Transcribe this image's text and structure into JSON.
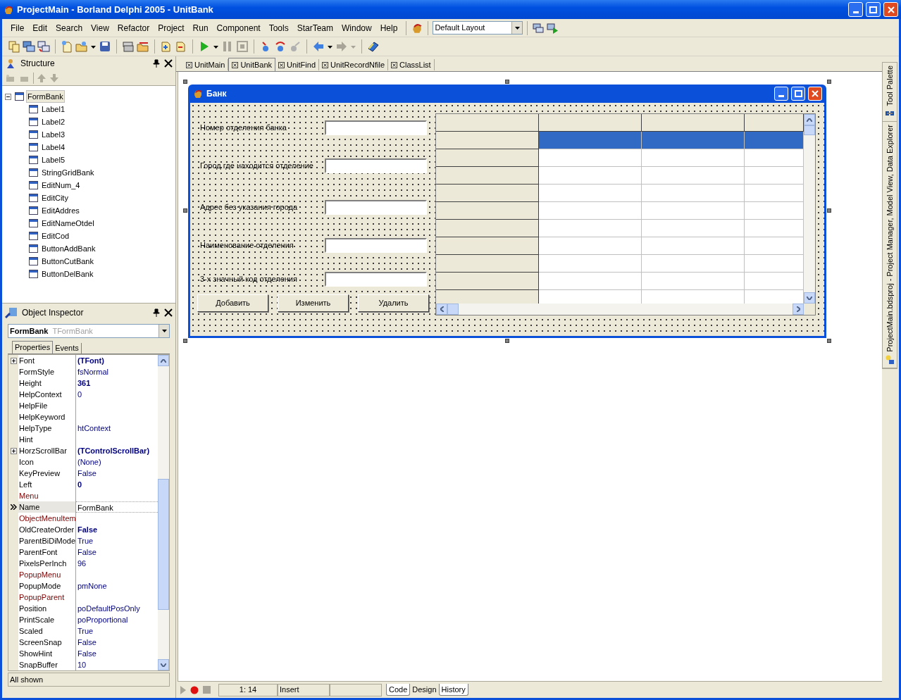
{
  "window": {
    "title": "ProjectMain - Borland Delphi 2005 - UnitBank"
  },
  "menu": [
    "File",
    "Edit",
    "Search",
    "View",
    "Refactor",
    "Project",
    "Run",
    "Component",
    "Tools",
    "StarTeam",
    "Window",
    "Help"
  ],
  "layout_selector": {
    "value": "Default Layout"
  },
  "structure": {
    "title": "Structure",
    "tree": [
      {
        "label": "FormBank",
        "expanded": true,
        "selected": true,
        "children": [
          {
            "label": "Label1",
            "selected": false
          },
          {
            "label": "Label2",
            "selected": false
          },
          {
            "label": "Label3",
            "selected": false
          },
          {
            "label": "Label4",
            "selected": false
          },
          {
            "label": "Label5",
            "selected": false
          },
          {
            "label": "StringGridBank",
            "selected": false
          },
          {
            "label": "EditNum_4",
            "selected": false
          },
          {
            "label": "EditCity",
            "selected": false
          },
          {
            "label": "EditAddres",
            "selected": false
          },
          {
            "label": "EditNameOtdel",
            "selected": false
          },
          {
            "label": "EditCod",
            "selected": false
          },
          {
            "label": "ButtonAddBank",
            "selected": false
          },
          {
            "label": "ButtonCutBank",
            "selected": false
          },
          {
            "label": "ButtonDelBank",
            "selected": false
          }
        ]
      }
    ]
  },
  "object_inspector": {
    "title": "Object Inspector",
    "object_name": "FormBank",
    "object_class": "TFormBank",
    "tabs": [
      {
        "label": "Properties",
        "selected": true
      },
      {
        "label": "Events",
        "selected": false
      }
    ],
    "properties": [
      {
        "name": "Font",
        "value": "(TFont)",
        "kind": "object",
        "modified": true,
        "selected": false
      },
      {
        "name": "FormStyle",
        "value": "fsNormal",
        "kind": "plain",
        "modified": false,
        "selected": false
      },
      {
        "name": "Height",
        "value": "361",
        "kind": "plain",
        "modified": true,
        "selected": false
      },
      {
        "name": "HelpContext",
        "value": "0",
        "kind": "plain",
        "modified": false,
        "selected": false
      },
      {
        "name": "HelpFile",
        "kind": "plain",
        "selected": false
      },
      {
        "name": "HelpKeyword",
        "kind": "plain",
        "selected": false
      },
      {
        "name": "HelpType",
        "value": "htContext",
        "kind": "plain",
        "modified": false,
        "selected": false
      },
      {
        "name": "Hint",
        "kind": "plain",
        "selected": false
      },
      {
        "name": "HorzScrollBar",
        "value": "(TControlScrollBar)",
        "kind": "object",
        "modified": true,
        "selected": false
      },
      {
        "name": "Icon",
        "value": "(None)",
        "kind": "plain",
        "modified": false,
        "selected": false
      },
      {
        "name": "KeyPreview",
        "value": "False",
        "kind": "plain",
        "modified": false,
        "selected": false
      },
      {
        "name": "Left",
        "value": "0",
        "kind": "plain",
        "modified": true,
        "selected": false
      },
      {
        "name": "Menu",
        "kind": "reference",
        "selected": false
      },
      {
        "name": "Name",
        "value": "FormBank",
        "kind": "plain",
        "modified": false,
        "selected": true
      },
      {
        "name": "ObjectMenuItem",
        "kind": "reference",
        "selected": false
      },
      {
        "name": "OldCreateOrder",
        "value": "False",
        "kind": "plain",
        "modified": true,
        "selected": false
      },
      {
        "name": "ParentBiDiMode",
        "value": "True",
        "kind": "plain",
        "modified": false,
        "selected": false
      },
      {
        "name": "ParentFont",
        "value": "False",
        "kind": "plain",
        "modified": false,
        "selected": false
      },
      {
        "name": "PixelsPerInch",
        "value": "96",
        "kind": "plain",
        "modified": false,
        "selected": false
      },
      {
        "name": "PopupMenu",
        "kind": "reference",
        "selected": false
      },
      {
        "name": "PopupMode",
        "value": "pmNone",
        "kind": "plain",
        "modified": false,
        "selected": false
      },
      {
        "name": "PopupParent",
        "kind": "reference",
        "selected": false
      },
      {
        "name": "Position",
        "value": "poDefaultPosOnly",
        "kind": "plain",
        "modified": false,
        "selected": false
      },
      {
        "name": "PrintScale",
        "value": "poProportional",
        "kind": "plain",
        "modified": false,
        "selected": false
      },
      {
        "name": "Scaled",
        "value": "True",
        "kind": "plain",
        "modified": false,
        "selected": false
      },
      {
        "name": "ScreenSnap",
        "value": "False",
        "kind": "plain",
        "modified": false,
        "selected": false
      },
      {
        "name": "ShowHint",
        "value": "False",
        "kind": "plain",
        "modified": false,
        "selected": false
      },
      {
        "name": "SnapBuffer",
        "value": "10",
        "kind": "plain",
        "modified": false,
        "selected": false
      }
    ],
    "status": "All shown"
  },
  "editor_tabs": [
    {
      "label": "UnitMain",
      "selected": false
    },
    {
      "label": "UnitBank",
      "selected": true
    },
    {
      "label": "UnitFind",
      "selected": false
    },
    {
      "label": "UnitRecordNfile",
      "selected": false
    },
    {
      "label": "ClassList",
      "selected": false
    }
  ],
  "form": {
    "title": "Банк",
    "fields": [
      {
        "label": "Номер отделения банка"
      },
      {
        "label": "Город где находится отделение"
      },
      {
        "label": "Адрес без указания города"
      },
      {
        "label": "Наименование отделения"
      },
      {
        "label": "3-х значный код отделения"
      }
    ],
    "buttons": [
      "Добавить",
      "Изменить",
      "Удалить"
    ],
    "grid": {
      "rows": [
        {
          "selected": true
        },
        {
          "selected": false
        },
        {
          "selected": false
        },
        {
          "selected": false
        },
        {
          "selected": false
        },
        {
          "selected": false
        },
        {
          "selected": false
        },
        {
          "selected": false
        },
        {
          "selected": false
        },
        {
          "selected": false
        }
      ]
    }
  },
  "status_bar": {
    "position": "1: 14",
    "mode": "Insert",
    "view_tabs": [
      {
        "label": "Code",
        "selected": false
      },
      {
        "label": "Design",
        "selected": true
      },
      {
        "label": "History",
        "selected": false
      }
    ]
  },
  "side_tabs": [
    {
      "label": "Tool Palette"
    },
    {
      "label": "ProjectMain.bdsproj - Project Manager, Model View, Data Explorer"
    }
  ]
}
